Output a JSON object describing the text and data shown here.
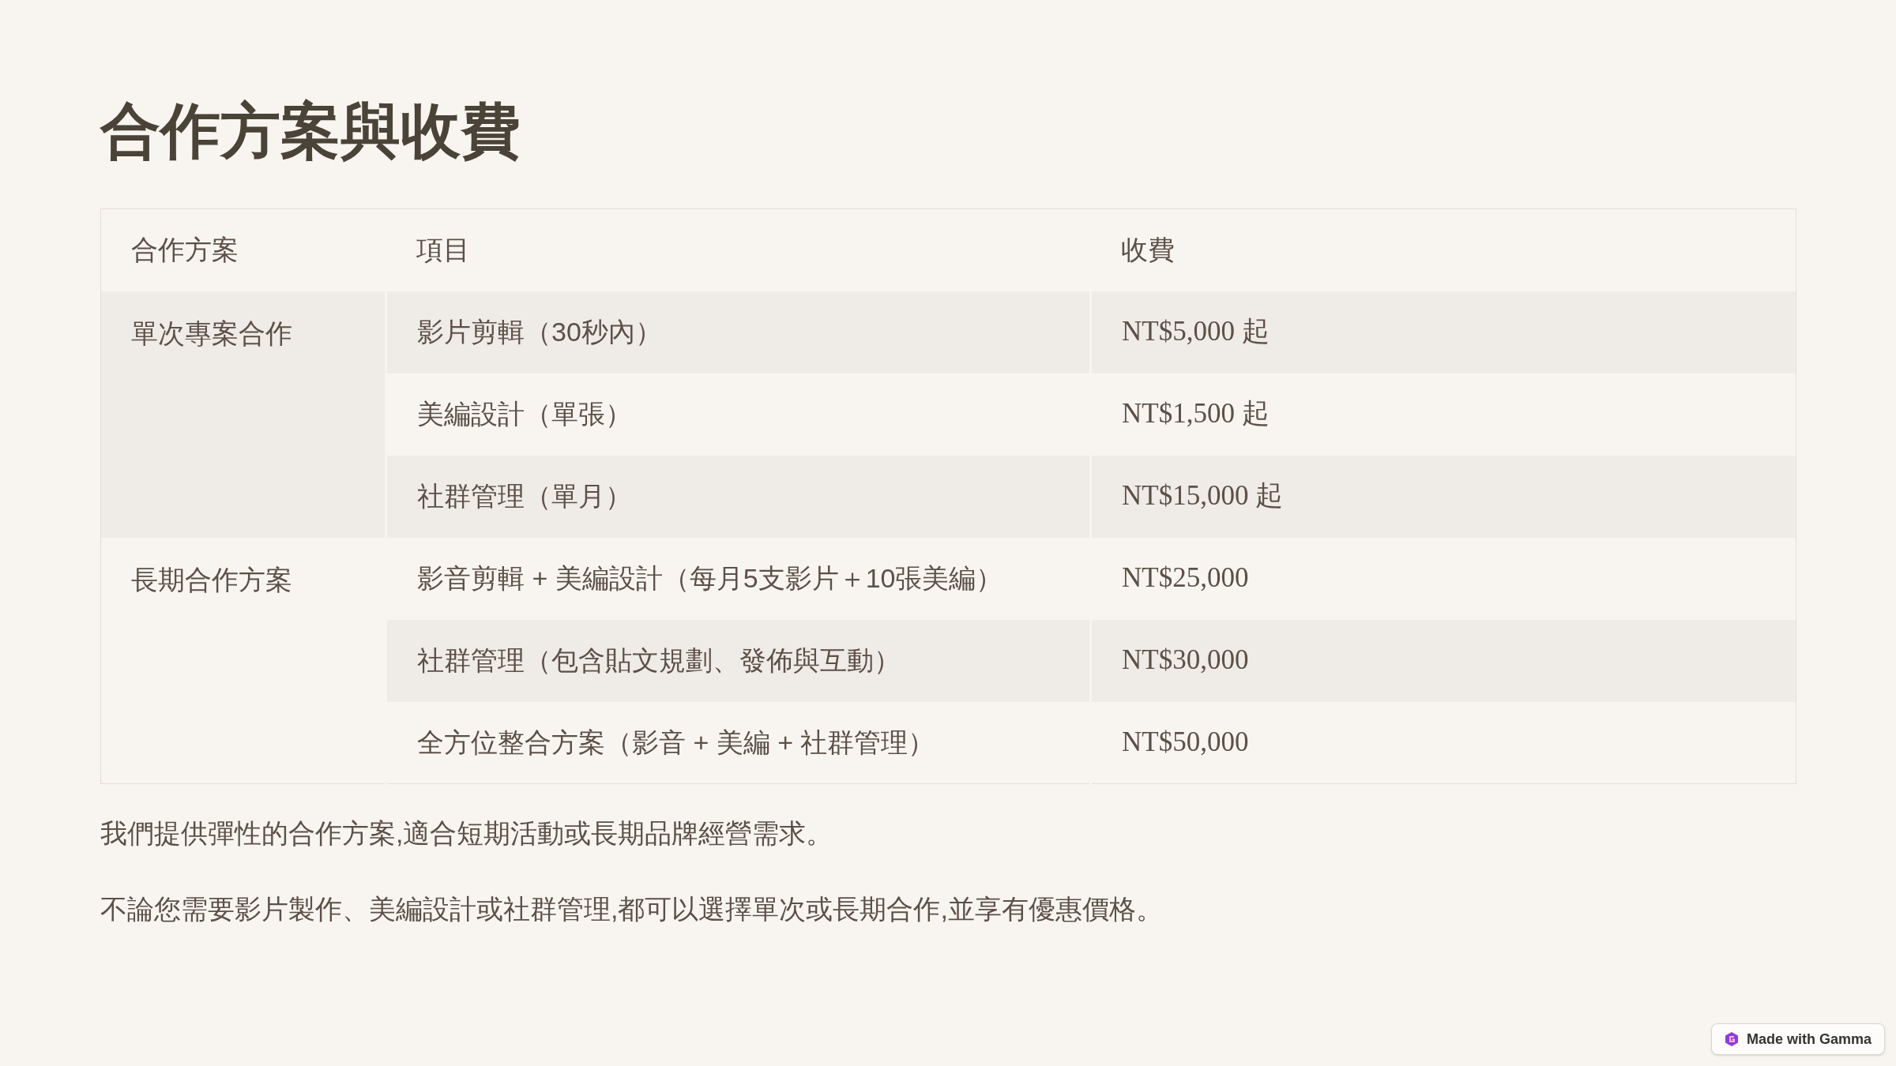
{
  "title": "合作方案與收費",
  "table": {
    "columns": [
      "合作方案",
      "項目",
      "收費"
    ],
    "groups": [
      {
        "plan": "單次專案合作",
        "rows": [
          {
            "item": "影片剪輯（30秒內）",
            "fee": "NT$5,000 起"
          },
          {
            "item": "美編設計（單張）",
            "fee": "NT$1,500 起"
          },
          {
            "item": "社群管理（單月）",
            "fee": "NT$15,000 起"
          }
        ]
      },
      {
        "plan": "長期合作方案",
        "rows": [
          {
            "item": "影音剪輯 + 美編設計（每月5支影片＋10張美編）",
            "fee": "NT$25,000"
          },
          {
            "item": "社群管理（包含貼文規劃、發佈與互動）",
            "fee": "NT$30,000"
          },
          {
            "item": "全方位整合方案（影音 + 美編 + 社群管理）",
            "fee": "NT$50,000"
          }
        ]
      }
    ]
  },
  "paragraphs": [
    "我們提供彈性的合作方案,適合短期活動或長期品牌經營需求。",
    "不論您需要影片製作、美編設計或社群管理,都可以選擇單次或長期合作,並享有優惠價格。"
  ],
  "badge": "Made with Gamma"
}
